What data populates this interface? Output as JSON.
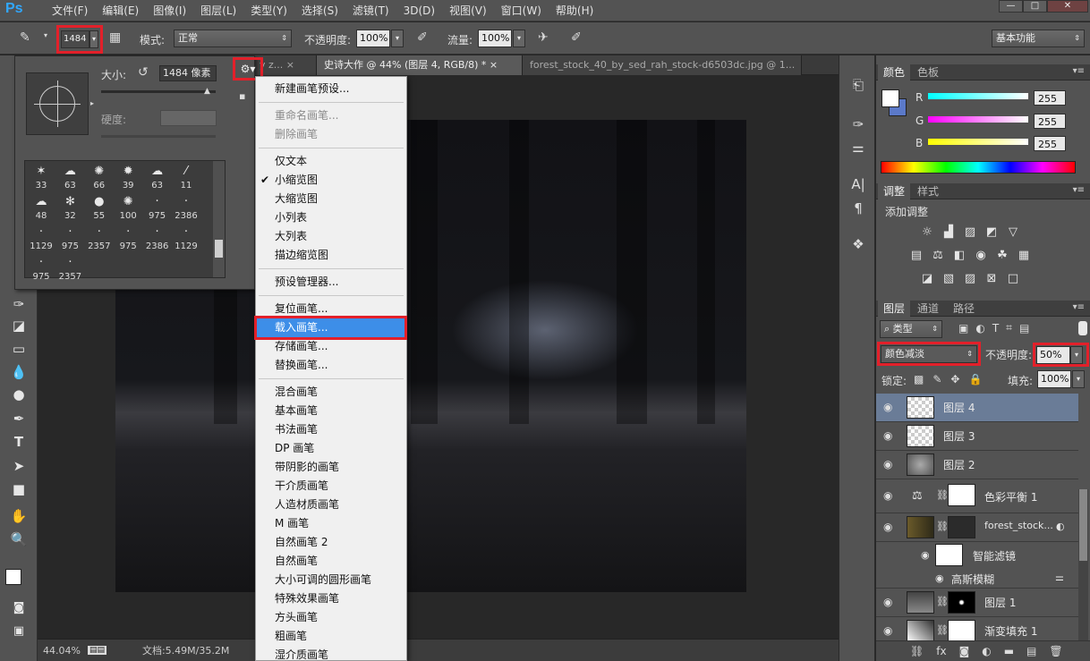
{
  "app": {
    "logo": "Ps"
  },
  "menubar": {
    "items": [
      "文件(F)",
      "编辑(E)",
      "图像(I)",
      "图层(L)",
      "类型(Y)",
      "选择(S)",
      "滤镜(T)",
      "3D(D)",
      "视图(V)",
      "窗口(W)",
      "帮助(H)"
    ],
    "min": "—",
    "max": "□",
    "close": "✕"
  },
  "options": {
    "brush_size": "1484",
    "mode_label": "模式:",
    "mode_value": "正常",
    "opacity_label": "不透明度:",
    "opacity_value": "100%",
    "flow_label": "流量:",
    "flow_value": "100%",
    "workspace": "基本功能"
  },
  "doctabs": [
    {
      "label": "y z... ×",
      "active": false
    },
    {
      "label": "史诗大作 @ 44% (图层 4, RGB/8) * ×",
      "active": true
    },
    {
      "label": "forest_stock_40_by_sed_rah_stock-d6503dc.jpg @ 1...",
      "active": false
    }
  ],
  "status": {
    "zoom": "44.04%",
    "doc": "文档:5.49M/35.2M"
  },
  "brush_popup": {
    "size_label": "大小:",
    "size_value": "1484 像素",
    "hardness_label": "硬度:",
    "presets": [
      {
        "n": "33",
        "g": "✶"
      },
      {
        "n": "63",
        "g": "☁"
      },
      {
        "n": "66",
        "g": "✺"
      },
      {
        "n": "39",
        "g": "✹"
      },
      {
        "n": "63",
        "g": "☁"
      },
      {
        "n": "11",
        "g": "⁄"
      },
      {
        "n": "48",
        "g": "☁"
      },
      {
        "n": "32",
        "g": "✻"
      },
      {
        "n": "55",
        "g": "●"
      },
      {
        "n": "100",
        "g": "✺"
      },
      {
        "n": "975",
        "g": "·"
      },
      {
        "n": "2386",
        "g": "·"
      },
      {
        "n": "1129",
        "g": "·"
      },
      {
        "n": "975",
        "g": "·"
      },
      {
        "n": "2357",
        "g": "·"
      },
      {
        "n": "975",
        "g": "·"
      },
      {
        "n": "2386",
        "g": "·"
      },
      {
        "n": "1129",
        "g": "·"
      },
      {
        "n": "975",
        "g": "·"
      },
      {
        "n": "2357",
        "g": "·"
      }
    ]
  },
  "context_menu": [
    {
      "label": "新建画笔预设..."
    },
    {
      "sep": true
    },
    {
      "label": "重命名画笔...",
      "disabled": true
    },
    {
      "label": "删除画笔",
      "disabled": true
    },
    {
      "sep": true
    },
    {
      "label": "仅文本"
    },
    {
      "label": "小缩览图",
      "checked": true
    },
    {
      "label": "大缩览图"
    },
    {
      "label": "小列表"
    },
    {
      "label": "大列表"
    },
    {
      "label": "描边缩览图"
    },
    {
      "sep": true
    },
    {
      "label": "预设管理器..."
    },
    {
      "sep": true
    },
    {
      "label": "复位画笔..."
    },
    {
      "label": "载入画笔...",
      "highlight": true
    },
    {
      "label": "存储画笔..."
    },
    {
      "label": "替换画笔..."
    },
    {
      "sep": true
    },
    {
      "label": "混合画笔"
    },
    {
      "label": "基本画笔"
    },
    {
      "label": "书法画笔"
    },
    {
      "label": "DP 画笔"
    },
    {
      "label": "带阴影的画笔"
    },
    {
      "label": "干介质画笔"
    },
    {
      "label": "人造材质画笔"
    },
    {
      "label": "M 画笔"
    },
    {
      "label": "自然画笔 2"
    },
    {
      "label": "自然画笔"
    },
    {
      "label": "大小可调的圆形画笔"
    },
    {
      "label": "特殊效果画笔"
    },
    {
      "label": "方头画笔"
    },
    {
      "label": "粗画笔"
    },
    {
      "label": "湿介质画笔"
    }
  ],
  "color_panel": {
    "tabs": [
      "颜色",
      "色板"
    ],
    "r_label": "R",
    "g_label": "G",
    "b_label": "B",
    "r": "255",
    "g": "255",
    "b": "255"
  },
  "adjust_panel": {
    "tabs": [
      "调整",
      "样式"
    ],
    "title": "添加调整"
  },
  "layers_panel": {
    "tabs": [
      "图层",
      "通道",
      "路径"
    ],
    "filter": "类型",
    "blend_mode": "颜色减淡",
    "opacity_label": "不透明度:",
    "opacity": "50%",
    "lock_label": "锁定:",
    "fill_label": "填充:",
    "fill": "100%",
    "layers": [
      {
        "name": "图层 4"
      },
      {
        "name": "图层 3"
      },
      {
        "name": "图层 2"
      },
      {
        "name": "色彩平衡 1"
      },
      {
        "name": "forest_stock..."
      },
      {
        "name": "智能滤镜"
      },
      {
        "name": "高斯模糊"
      },
      {
        "name": "图层 1"
      },
      {
        "name": "渐变填充 1"
      }
    ]
  }
}
